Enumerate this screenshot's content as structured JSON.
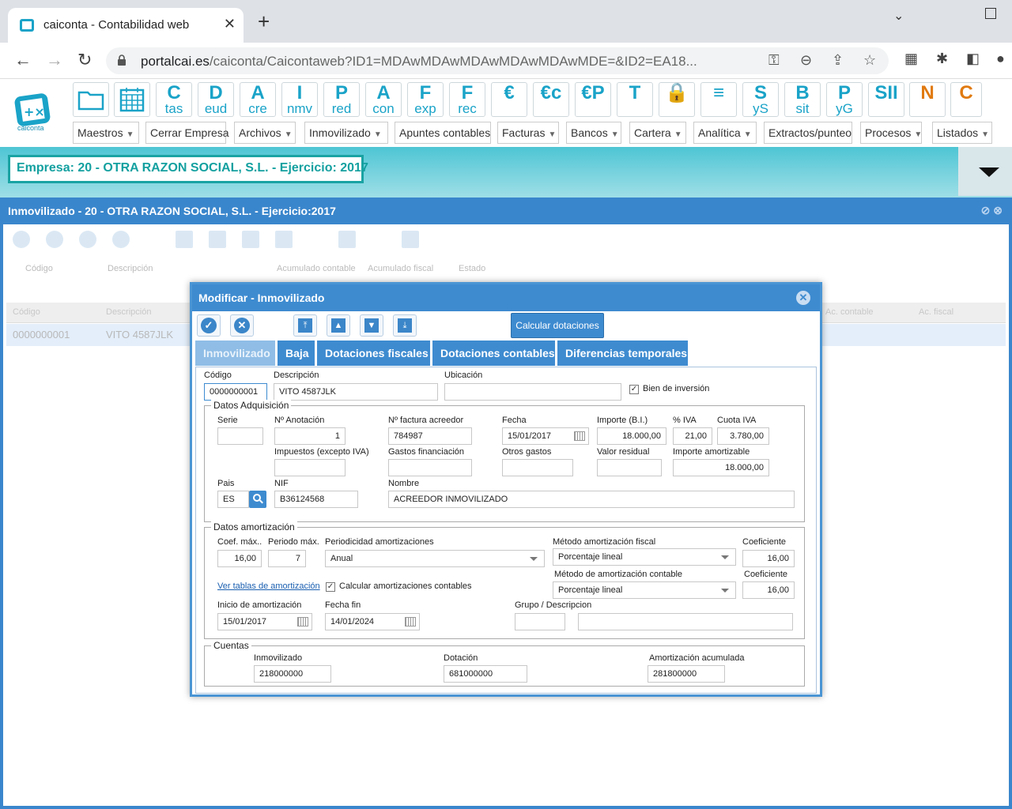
{
  "browser": {
    "tab_title": "caiconta - Contabilidad web",
    "url_host": "portalcai.es",
    "url_path": "/caiconta/Caicontaweb?ID1=MDAwMDAwMDAwMDAwMDAwMDE=&ID2=EA18..."
  },
  "app": {
    "logo_text": "caiconta",
    "toolbar_icons": [
      {
        "big": "",
        "small": "",
        "name": "folder-icon"
      },
      {
        "big": "",
        "small": "",
        "name": "calendar-icon"
      },
      {
        "big": "C",
        "small": "tas",
        "name": "cuentas-icon"
      },
      {
        "big": "D",
        "small": "eud",
        "name": "deudores-icon"
      },
      {
        "big": "A",
        "small": "cre",
        "name": "acreedores-icon"
      },
      {
        "big": "I",
        "small": "nmv",
        "name": "inmovilizado-icon"
      },
      {
        "big": "P",
        "small": "red",
        "name": "predefinidos-icon"
      },
      {
        "big": "A",
        "small": "con",
        "name": "apuntes-icon"
      },
      {
        "big": "F",
        "small": "exp",
        "name": "facturas-expedidas-icon"
      },
      {
        "big": "F",
        "small": "rec",
        "name": "facturas-recibidas-icon"
      },
      {
        "big": "€",
        "small": "",
        "name": "money-bag-icon"
      },
      {
        "big": "€c",
        "small": "",
        "name": "cobros-icon"
      },
      {
        "big": "€P",
        "small": "",
        "name": "pagos-icon"
      },
      {
        "big": "T",
        "small": "",
        "name": "debe-haber-icon"
      },
      {
        "big": "🔒",
        "small": "",
        "name": "lock-icon"
      },
      {
        "big": "≡",
        "small": "",
        "name": "list-icon"
      },
      {
        "big": "S",
        "small": "yS",
        "name": "sumas-saldos-icon"
      },
      {
        "big": "B",
        "small": "sit",
        "name": "balance-situacion-icon"
      },
      {
        "big": "P",
        "small": "yG",
        "name": "perdidas-ganancias-icon"
      },
      {
        "big": "SII",
        "small": "",
        "name": "sii-icon"
      },
      {
        "big": "N",
        "small": "",
        "name": "n-icon"
      },
      {
        "big": "C",
        "small": "",
        "name": "c-icon"
      }
    ],
    "menus": [
      "Maestros",
      "Cerrar Empresa",
      "Archivos",
      "Inmovilizado",
      "Apuntes contables",
      "Facturas",
      "Bancos",
      "Cartera",
      "Analítica",
      "Extractos/punteo",
      "Procesos",
      "Listados"
    ],
    "empresa": "Empresa: 20 - OTRA RAZON SOCIAL, S.L. - Ejercicio: 2017"
  },
  "inm_window": {
    "title": "Inmovilizado - 20 - OTRA RAZON SOCIAL, S.L. - Ejercicio:2017",
    "filter_labels": [
      "Código",
      "Descripción",
      "Acumulado contable",
      "Acumulado fiscal",
      "Estado"
    ],
    "grid_headers": [
      "Código",
      "Descripción",
      "Ac. contable",
      "Ac. fiscal"
    ],
    "grid_row": {
      "codigo": "0000000001",
      "descripcion": "VITO 4587JLK"
    }
  },
  "modal": {
    "title": "Modificar - Inmovilizado",
    "calc_button": "Calcular dotaciones",
    "tabs": [
      "Inmovilizado",
      "Baja",
      "Dotaciones fiscales",
      "Dotaciones contables",
      "Diferencias temporales"
    ],
    "codigo_label": "Código",
    "codigo": "0000000001",
    "descripcion_label": "Descripción",
    "descripcion": "VITO 4587JLK",
    "ubicacion_label": "Ubicación",
    "ubicacion": "",
    "bien_inversion_label": "Bien de inversión",
    "bien_inversion": true,
    "adq": {
      "legend": "Datos Adquisición",
      "serie_label": "Serie",
      "serie": "",
      "anotacion_label": "Nº Anotación",
      "anotacion": "1",
      "factura_label": "Nº factura acreedor",
      "factura": "784987",
      "fecha_label": "Fecha",
      "fecha": "15/01/2017",
      "importe_label": "Importe (B.I.)",
      "importe": "18.000,00",
      "iva_label": "% IVA",
      "iva": "21,00",
      "cuota_label": "Cuota IVA",
      "cuota": "3.780,00",
      "impuestos_label": "Impuestos (excepto IVA)",
      "impuestos": "",
      "gastos_fin_label": "Gastos financiación",
      "gastos_fin": "",
      "otros_label": "Otros gastos",
      "otros": "",
      "residual_label": "Valor residual",
      "residual": "",
      "amortizable_label": "Importe amortizable",
      "amortizable": "18.000,00",
      "pais_label": "Pais",
      "pais": "ES",
      "nif_label": "NIF",
      "nif": "B36124568",
      "nombre_label": "Nombre",
      "nombre": "ACREEDOR INMOVILIZADO"
    },
    "amort": {
      "legend": "Datos amortización",
      "coef_max_label": "Coef. máx..",
      "coef_max": "16,00",
      "periodo_label": "Periodo máx.",
      "periodo": "7",
      "periodicidad_label": "Periodicidad amortizaciones",
      "periodicidad": "Anual",
      "metodo_fiscal_label": "Método amortización fiscal",
      "metodo_fiscal": "Porcentaje lineal",
      "coef_fiscal_label": "Coeficiente",
      "coef_fiscal": "16,00",
      "metodo_contable_label": "Método de amortización contable",
      "metodo_contable": "Porcentaje lineal",
      "coef_contable_label": "Coeficiente",
      "coef_contable": "16,00",
      "ver_tablas": "Ver tablas de amortización",
      "calc_contables_label": "Calcular amortizaciones contables",
      "calc_contables": true,
      "inicio_label": "Inicio de amortización",
      "inicio": "15/01/2017",
      "fin_label": "Fecha fin",
      "fin": "14/01/2024",
      "grupo_label": "Grupo / Descripcion",
      "grupo": "",
      "grupo_desc": ""
    },
    "cuentas": {
      "legend": "Cuentas",
      "inmovilizado_label": "Inmovilizado",
      "inmovilizado": "218000000",
      "dotacion_label": "Dotación",
      "dotacion": "681000000",
      "amort_label": "Amortización acumulada",
      "amort": "281800000"
    }
  }
}
